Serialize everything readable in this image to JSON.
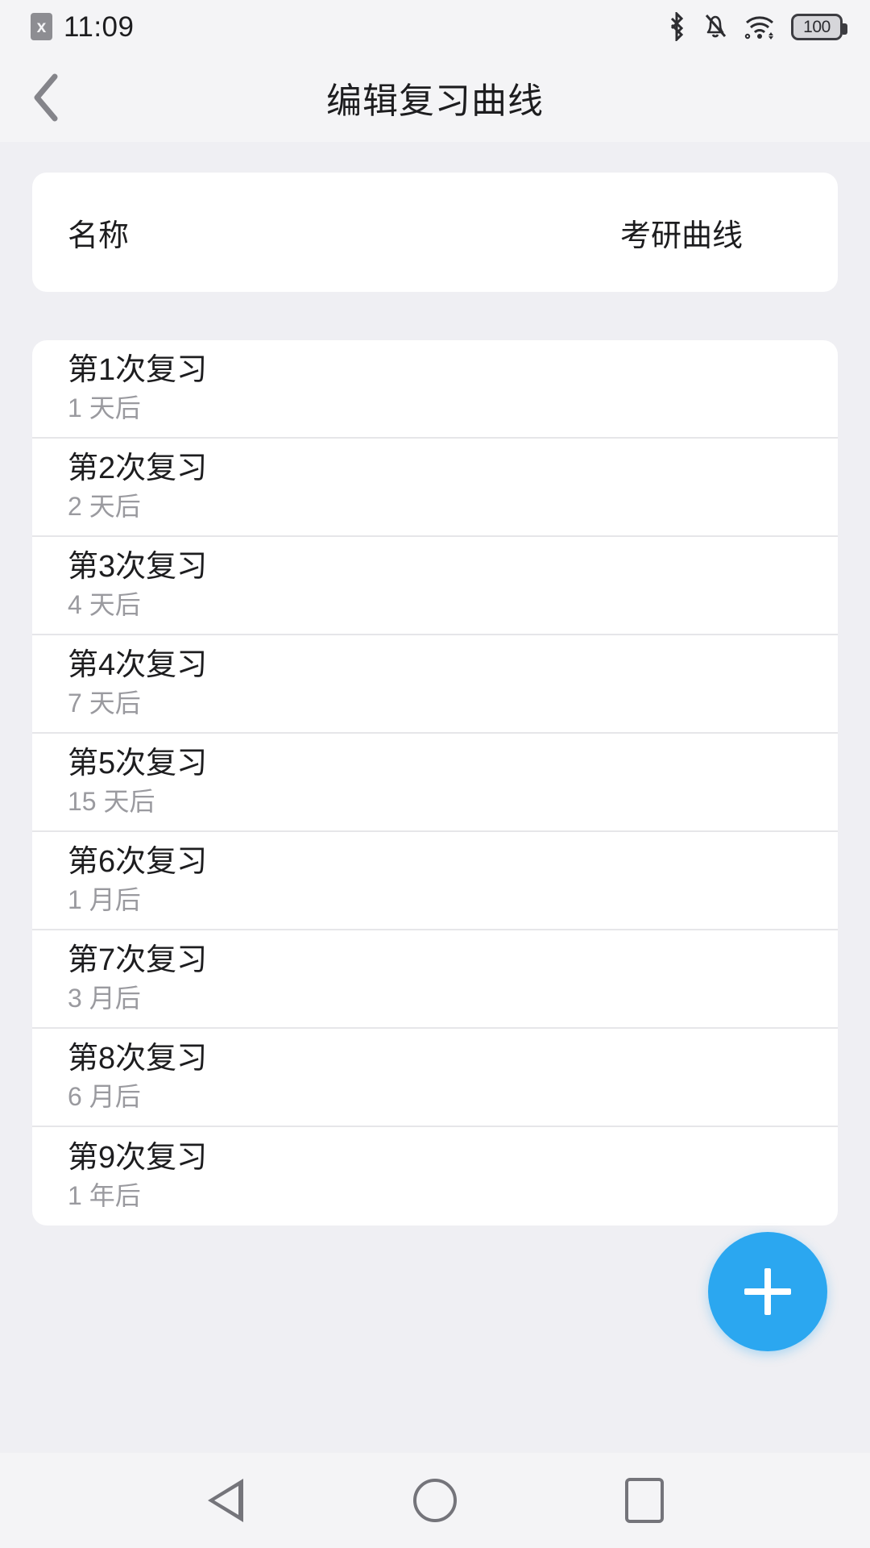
{
  "status_bar": {
    "sim_icon_glyph": "x",
    "time": "11:09",
    "battery_level": "100",
    "icons": [
      "sim-x-icon",
      "bluetooth-icon",
      "bell-muted-icon",
      "wifi-icon",
      "battery-icon"
    ]
  },
  "header": {
    "back_icon": "chevron-left-icon",
    "title": "编辑复习曲线"
  },
  "name_card": {
    "label": "名称",
    "value": "考研曲线"
  },
  "review_list": [
    {
      "title": "第1次复习",
      "subtitle": "1 天后"
    },
    {
      "title": "第2次复习",
      "subtitle": "2 天后"
    },
    {
      "title": "第3次复习",
      "subtitle": "4 天后"
    },
    {
      "title": "第4次复习",
      "subtitle": "7 天后"
    },
    {
      "title": "第5次复习",
      "subtitle": "15 天后"
    },
    {
      "title": "第6次复习",
      "subtitle": "1 月后"
    },
    {
      "title": "第7次复习",
      "subtitle": "3 月后"
    },
    {
      "title": "第8次复习",
      "subtitle": "6 月后"
    },
    {
      "title": "第9次复习",
      "subtitle": "1 年后"
    }
  ],
  "fab": {
    "icon": "plus-icon",
    "color": "#2ba7f0"
  },
  "nav_bar": {
    "back": "triangle-back-icon",
    "home": "circle-home-icon",
    "recents": "square-recents-icon"
  },
  "colors": {
    "page_background": "#efeff3",
    "bar_background": "#f4f4f6",
    "card_background": "#ffffff",
    "primary_text": "#1d1d1f",
    "secondary_text": "#9a9a9f",
    "accent": "#2ba7f0"
  }
}
